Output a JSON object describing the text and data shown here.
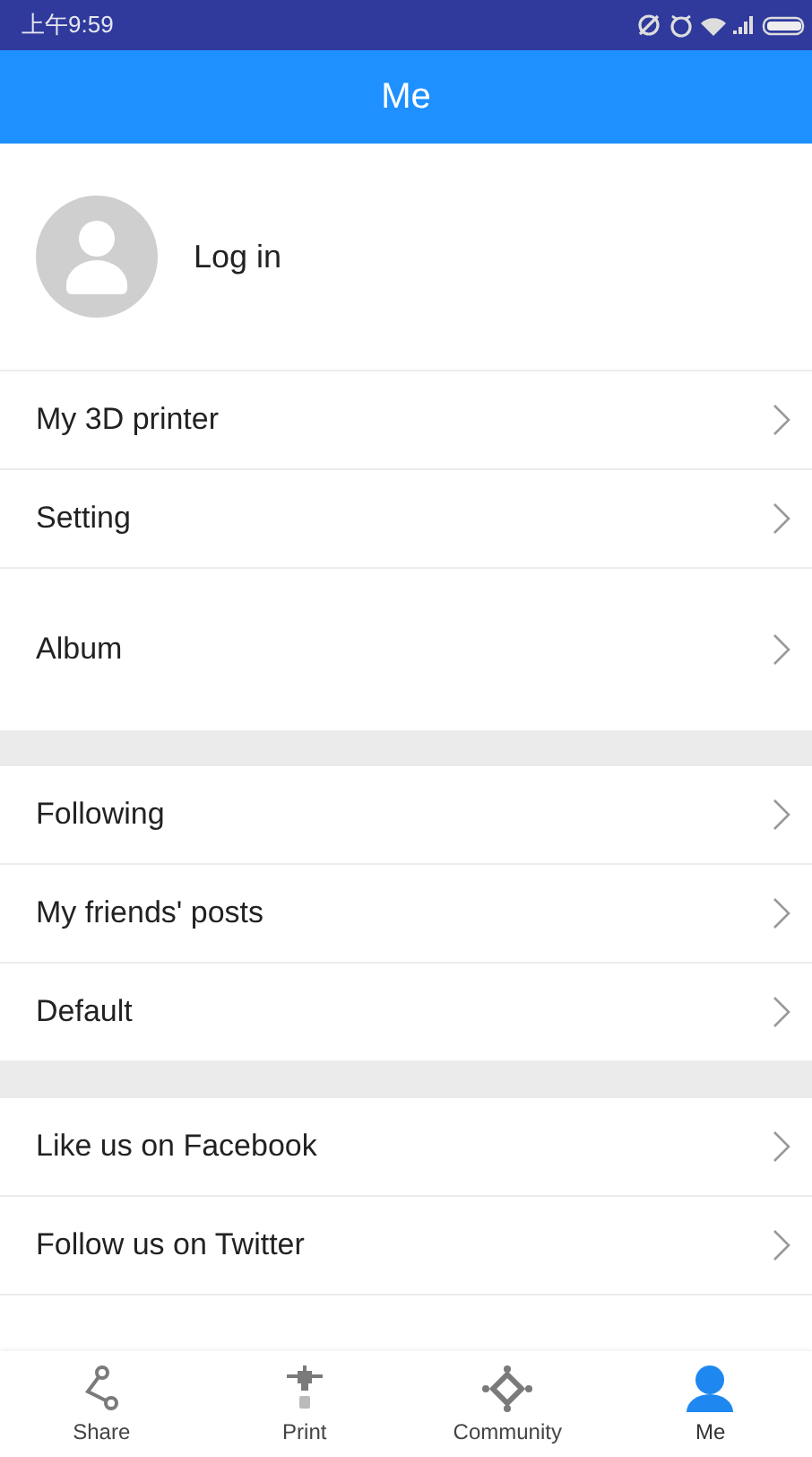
{
  "status_bar": {
    "time": "上午9:59"
  },
  "header": {
    "title": "Me"
  },
  "profile": {
    "label": "Log in"
  },
  "sections": [
    {
      "items": [
        {
          "label": "My 3D printer"
        },
        {
          "label": "Setting"
        },
        {
          "label": "Album"
        }
      ]
    },
    {
      "items": [
        {
          "label": "Following"
        },
        {
          "label": "My friends' posts"
        },
        {
          "label": "Default"
        }
      ]
    },
    {
      "items": [
        {
          "label": "Like us on Facebook"
        },
        {
          "label": "Follow us on Twitter"
        }
      ]
    }
  ],
  "tabs": [
    {
      "label": "Share",
      "kind": "share",
      "selected": false
    },
    {
      "label": "Print",
      "kind": "print",
      "selected": false
    },
    {
      "label": "Community",
      "kind": "community",
      "selected": false
    },
    {
      "label": "Me",
      "kind": "me",
      "selected": true
    }
  ]
}
